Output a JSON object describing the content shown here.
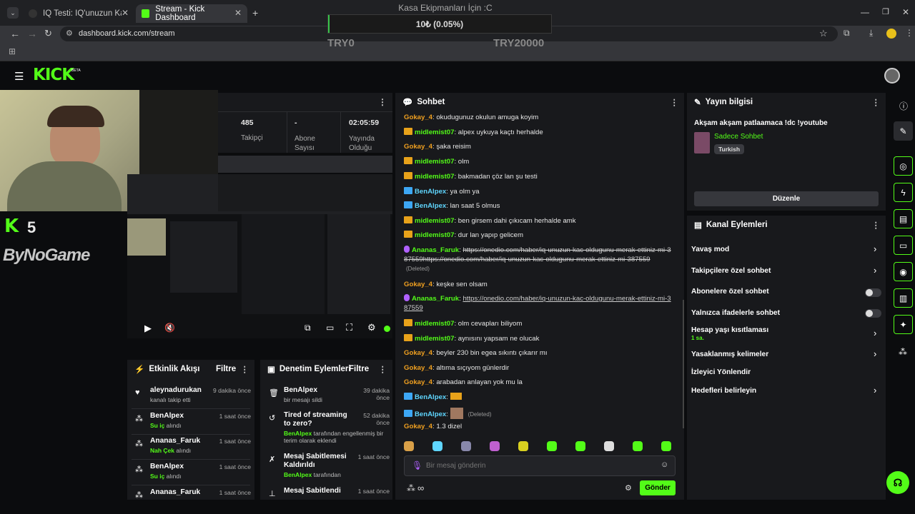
{
  "browser": {
    "tabs": [
      {
        "title": "IQ Testi: IQ'unuzun Kaç Olduğu"
      },
      {
        "title": "Stream - Kick Dashboard"
      }
    ],
    "url": "dashboard.kick.com/stream"
  },
  "donation": {
    "title": "Kasa Ekipmanları İçin :C",
    "progress_text": "10₺ (0.05%)",
    "progress_fraction": 0.0005,
    "min_label": "TRY0",
    "max_label": "TRY20000"
  },
  "kick": {
    "logo": "KICK",
    "beta": "BETA"
  },
  "overlay": {
    "kick_count": "5",
    "sponsor": "ByNoGame"
  },
  "stats": {
    "followers_value": "485",
    "followers_label": "Takipçi",
    "subs_value": "-",
    "subs_label": "Abone Sayısı",
    "uptime_value": "02:05:59",
    "uptime_label": "Yayında Olduğu"
  },
  "chat": {
    "title": "Sohbet",
    "placeholder": "Bir mesaj gönderin",
    "send_label": "Gönder",
    "messages": [
      {
        "user": "Gokay_4",
        "color": "orange",
        "badge": "",
        "text": ": okudugunuz okulun amuga koyim"
      },
      {
        "user": "midlemist07",
        "color": "green",
        "badge": "crown",
        "text": ": alpex uykuya kaçtı herhalde"
      },
      {
        "user": "Gokay_4",
        "color": "orange",
        "badge": "",
        "text": ": şaka reisim"
      },
      {
        "user": "midlemist07",
        "color": "green",
        "badge": "crown",
        "text": ": olm"
      },
      {
        "user": "midlemist07",
        "color": "green",
        "badge": "crown",
        "text": ": bakmadan çöz lan şu testi"
      },
      {
        "user": "BenAlpex",
        "color": "cyan",
        "badge": "mod",
        "text": ": ya olm ya"
      },
      {
        "user": "BenAlpex",
        "color": "cyan",
        "badge": "mod",
        "text": ": lan saat 5 olmus"
      },
      {
        "user": "midlemist07",
        "color": "green",
        "badge": "crown",
        "text": ": ben girsem dahi çıkıcam herhalde amk"
      },
      {
        "user": "midlemist07",
        "color": "green",
        "badge": "crown",
        "text": ": dur lan yapıp gelicem"
      },
      {
        "user": "Ananas_Faruk",
        "color": "green",
        "badge": "sub",
        "text": ": ",
        "link": "https://onedio.com/haber/iq-unuzun-kac-oldugunu-merak-ettiniz-mi-387559https://onedio.com/haber/iq-unuzun-kac-oldugunu-merak-ettiniz-mi-387559",
        "deleted": "(Deleted)"
      },
      {
        "user": "Gokay_4",
        "color": "orange",
        "badge": "",
        "text": ": keşke sen olsam"
      },
      {
        "user": "Ananas_Faruk",
        "color": "green",
        "badge": "sub",
        "text": ": ",
        "link": "https://onedio.com/haber/iq-unuzun-kac-oldugunu-merak-ettiniz-mi-387559"
      },
      {
        "user": "midlemist07",
        "color": "green",
        "badge": "crown",
        "text": ": olm cevapları biliyom"
      },
      {
        "user": "midlemist07",
        "color": "green",
        "badge": "crown",
        "text": ": aynısını yapsam ne olucak"
      },
      {
        "user": "Gokay_4",
        "color": "orange",
        "badge": "",
        "text": ": beyler 230 bin egea sıkıntı çıkarır mı"
      },
      {
        "user": "Gokay_4",
        "color": "orange",
        "badge": "",
        "text": ": altıma sıçıyom günlerdir"
      },
      {
        "user": "Gokay_4",
        "color": "orange",
        "badge": "",
        "text": ": arabadan anlayan yok mu la"
      },
      {
        "user": "BenAlpex",
        "color": "cyan",
        "badge": "mod",
        "text": ": "
      },
      {
        "user": "BenAlpex",
        "color": "cyan",
        "badge": "mod",
        "text": ": ",
        "deleted": "(Deleted)"
      },
      {
        "user": "Gokay_4",
        "color": "orange",
        "badge": "",
        "text": ": 1.3 dizel"
      }
    ]
  },
  "activity": {
    "title": "Etkinlik Akışı",
    "filter": "Filtre",
    "items": [
      {
        "name": "aleynadurukan",
        "desc": "kanalı takip etti",
        "accent": "",
        "time": "9 dakika önce"
      },
      {
        "name": "BenAlpex",
        "accent": "Su iç",
        "desc": " alındı",
        "time": "1 saat önce"
      },
      {
        "name": "Ananas_Faruk",
        "accent": "Nah Çek",
        "desc": " alındı",
        "time": "1 saat önce"
      },
      {
        "name": "BenAlpex",
        "accent": "Su iç",
        "desc": " alındı",
        "time": "1 saat önce"
      },
      {
        "name": "Ananas_Faruk",
        "accent": "",
        "desc": "",
        "time": "1 saat önce"
      }
    ]
  },
  "moderation": {
    "title": "Denetim Eylemleri",
    "filter": "Filtre",
    "items": [
      {
        "name": "BenAlpex",
        "desc": "bir mesajı sildi",
        "time": "39 dakika önce"
      },
      {
        "name": "Tired of streaming to zero?",
        "accent": "BenAlpex",
        "desc": " tarafından engellenmiş bir terim olarak eklendi",
        "time": "52 dakika önce"
      },
      {
        "name": "Mesaj Sabitlemesi Kaldırıldı",
        "accent": "BenAlpex",
        "desc": " tarafından",
        "time": "1 saat önce"
      },
      {
        "name": "Mesaj Sabitlendi",
        "desc": "",
        "time": "1 saat önce"
      }
    ]
  },
  "stream_info": {
    "title": "Yayın bilgisi",
    "stream_title": "Akşam akşam patlaamaca !dc !youtube",
    "category": "Sadece Sohbet",
    "tag": "Turkish",
    "edit": "Düzenle"
  },
  "channel_actions": {
    "title": "Kanal Eylemleri",
    "slow_mode": "Yavaş mod",
    "followers_only": "Takipçilere özel sohbet",
    "subs_only": "Abonelere özel sohbet",
    "emotes_only": "Yalnızca ifadelerle sohbet",
    "account_age": "Hesap yaşı kısıtlaması",
    "account_age_value": "1 sa.",
    "banned_words": "Yasaklanmış kelimeler",
    "viewer_redirect": "İzleyici Yönlendir",
    "goals": "Hedefleri belirleyin"
  }
}
